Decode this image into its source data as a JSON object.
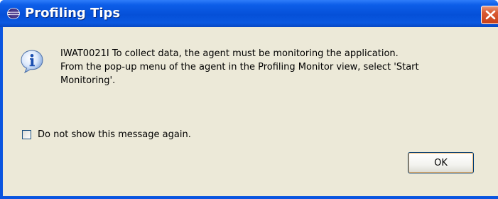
{
  "window": {
    "title": "Profiling Tips",
    "title_icon": "eclipse-icon",
    "close_icon": "close-icon",
    "titlebar_color": "#0a55e0",
    "close_color": "#d95a33"
  },
  "message": {
    "icon": "info-icon",
    "lines": [
      "IWAT0021I To collect data, the agent must be monitoring the application.",
      "From the pop-up menu of the agent in the Profiling Monitor view, select 'Start",
      "Monitoring'."
    ]
  },
  "checkbox": {
    "label": "Do not show this message again.",
    "checked": false
  },
  "buttons": {
    "ok_label": "OK"
  },
  "body_color": "#ece9d8"
}
